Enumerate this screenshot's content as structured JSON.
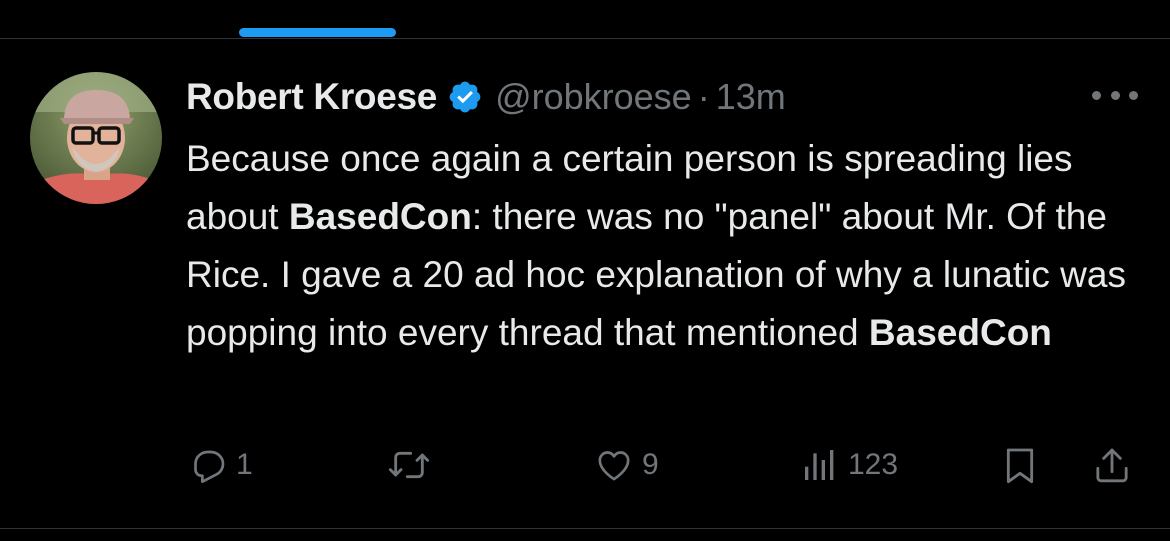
{
  "tweet": {
    "author": {
      "name": "Robert Kroese",
      "handle": "@robkroese",
      "verified": true
    },
    "separator": "·",
    "timestamp": "13m",
    "text_segments": [
      {
        "text": "Because once again a certain person is spreading lies about ",
        "bold": false
      },
      {
        "text": "BasedCon",
        "bold": true
      },
      {
        "text": ": there was no \"panel\" about Mr. Of the Rice. I gave a 20 ad hoc explanation of why a lunatic was popping into every thread that mentioned ",
        "bold": false
      },
      {
        "text": "BasedCon",
        "bold": true
      }
    ],
    "stats": {
      "replies": "1",
      "retweets": "",
      "likes": "9",
      "views": "123"
    }
  },
  "icons": {
    "reply": "reply-icon",
    "retweet": "retweet-icon",
    "like": "heart-icon",
    "views": "analytics-icon",
    "bookmark": "bookmark-icon",
    "share": "share-icon",
    "more": "more-icon",
    "verified": "verified-badge-icon"
  },
  "colors": {
    "background": "#000000",
    "text": "#e7e9ea",
    "muted": "#71767b",
    "accent": "#1d9bf0",
    "divider": "#2f3336"
  }
}
